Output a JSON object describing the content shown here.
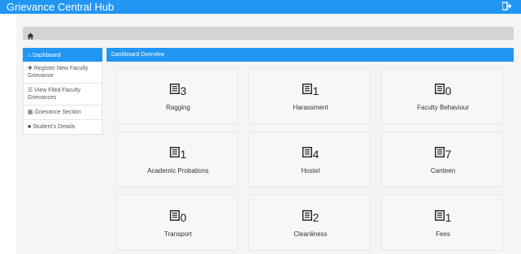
{
  "header": {
    "brand": "Grievance Central Hub",
    "logout_icon": "logout-icon"
  },
  "breadcrumb": {
    "icon": "home-icon"
  },
  "sidebar": {
    "items": [
      {
        "icon": "home-icon",
        "label": "Dashboard",
        "active": true
      },
      {
        "icon": "plus-icon",
        "label": "Register New Faculty Grievance",
        "active": false
      },
      {
        "icon": "list-icon",
        "label": "View Filed Faculty Grievances",
        "active": false
      },
      {
        "icon": "table-icon",
        "label": "Grievance Section",
        "active": false
      },
      {
        "icon": "user-square-icon",
        "label": "Student's Details",
        "active": false
      }
    ]
  },
  "panel": {
    "title": "Dashboard Overview"
  },
  "cards": [
    {
      "count": "3",
      "label": "Ragging"
    },
    {
      "count": "1",
      "label": "Harassment"
    },
    {
      "count": "0",
      "label": "Faculty Behaviour"
    },
    {
      "count": "1",
      "label": "Academic Probations"
    },
    {
      "count": "4",
      "label": "Hostel"
    },
    {
      "count": "7",
      "label": "Canteen"
    },
    {
      "count": "0",
      "label": "Transport"
    },
    {
      "count": "2",
      "label": "Cleanliness"
    },
    {
      "count": "1",
      "label": "Fees"
    }
  ],
  "colors": {
    "primary": "#2196f3",
    "breadcrumb": "#d3d3d3",
    "card_bg": "#f7f7f7"
  }
}
